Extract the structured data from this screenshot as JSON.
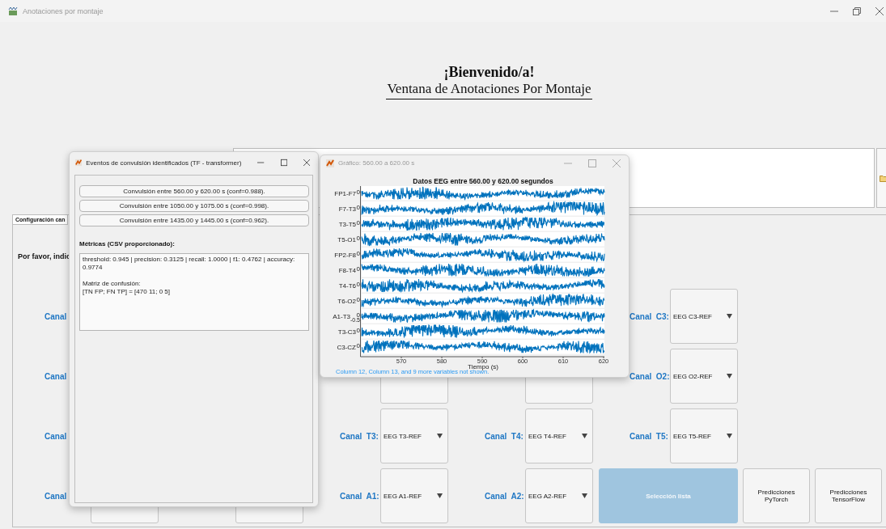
{
  "window": {
    "title": "Anotaciones por montaje"
  },
  "header": {
    "title": "¡Bienvenido/a!",
    "subtitle": "Ventana de Anotaciones Por Montaje"
  },
  "panel": {
    "title": "Configuración can",
    "prompt": "Por favor, indic",
    "rows": [
      [
        {
          "kind": "label_only",
          "label": "Canal"
        },
        {
          "kind": "covered"
        },
        {
          "kind": "covered"
        },
        {
          "kind": "covered"
        },
        {
          "kind": "dropdown",
          "label": "Canal  C3:",
          "value": "EEG C3-REF"
        }
      ],
      [
        {
          "kind": "label_only",
          "label": "Canal"
        },
        {
          "kind": "covered"
        },
        {
          "kind": "dropdown"
        },
        {
          "kind": "dropdown"
        },
        {
          "kind": "dropdown",
          "label": "Canal  O2:",
          "value": "EEG O2-REF"
        }
      ],
      [
        {
          "kind": "label_only",
          "label": "Canal"
        },
        {
          "kind": "covered"
        },
        {
          "kind": "dropdown",
          "label": "Canal  T3:",
          "value": "EEG T3-REF"
        },
        {
          "kind": "dropdown",
          "label": "Canal  T4:",
          "value": "EEG T4-REF"
        },
        {
          "kind": "dropdown",
          "label": "Canal  T5:",
          "value": "EEG T5-REF"
        }
      ],
      [
        {
          "kind": "dropdown",
          "label": "Canal"
        },
        {
          "kind": "dropdown"
        },
        {
          "kind": "dropdown",
          "label": "Canal  A1:",
          "value": "EEG A1-REF"
        },
        {
          "kind": "dropdown",
          "label": "Canal  A2:",
          "value": "EEG A2-REF"
        }
      ]
    ],
    "actions": [
      {
        "kind": "primary",
        "label": "Selección lista"
      },
      {
        "kind": "secondary",
        "label": "Predicciones PyTorch"
      },
      {
        "kind": "secondary",
        "label": "Predicciones TensorFlow"
      }
    ]
  },
  "events_dialog": {
    "title": "Eventos de convulsión identificados (TF - transformer)",
    "events": [
      "Convulsión entre 560.00 y 620.00 s (conf=0.988).",
      "Convulsión entre 1050.00 y 1075.00 s (conf=0.998).",
      "Convulsión entre 1435.00 y 1445.00 s (conf=0.962)."
    ],
    "metrics_label": "Métricas (CSV proporcionado):",
    "metrics_text": [
      "threshold: 0.945 | precision: 0.3125 | recall: 1.0000 | f1: 0.4762 | accuracy: 0.9774",
      "Matriz de confusión:\n[TN FP; FN TP] = [470 11; 0 5]"
    ]
  },
  "graph_window": {
    "title": "Gráfico: 560.00 a 620.00 s",
    "plot": {
      "title": "Datos EEG entre 560.00 y 620.00 segundos",
      "xlabel": "Tiempo (s)",
      "xticks": [
        "570",
        "580",
        "590",
        "600",
        "610",
        "620"
      ],
      "traces": [
        {
          "label": "FP1-F7",
          "ticks": [
            "0"
          ]
        },
        {
          "label": "F7-T3",
          "ticks": [
            "0"
          ]
        },
        {
          "label": "T3-T5",
          "ticks": [
            "0"
          ]
        },
        {
          "label": "T5-O1",
          "ticks": [
            "0"
          ]
        },
        {
          "label": "FP2-F8",
          "ticks": [
            "0"
          ]
        },
        {
          "label": "F8-T4",
          "ticks": [
            "0"
          ]
        },
        {
          "label": "T4-T6",
          "ticks": [
            "0"
          ]
        },
        {
          "label": "T6-O2",
          "ticks": [
            "0"
          ]
        },
        {
          "label": "A1-T3",
          "ticks": [
            "0",
            "-0.5"
          ]
        },
        {
          "label": "T3-C3",
          "ticks": [
            "0"
          ]
        },
        {
          "label": "C3-CZ",
          "ticks": [
            "0"
          ]
        }
      ]
    },
    "note": "Column 12, Column 13, and 9 more variables not shown."
  }
}
